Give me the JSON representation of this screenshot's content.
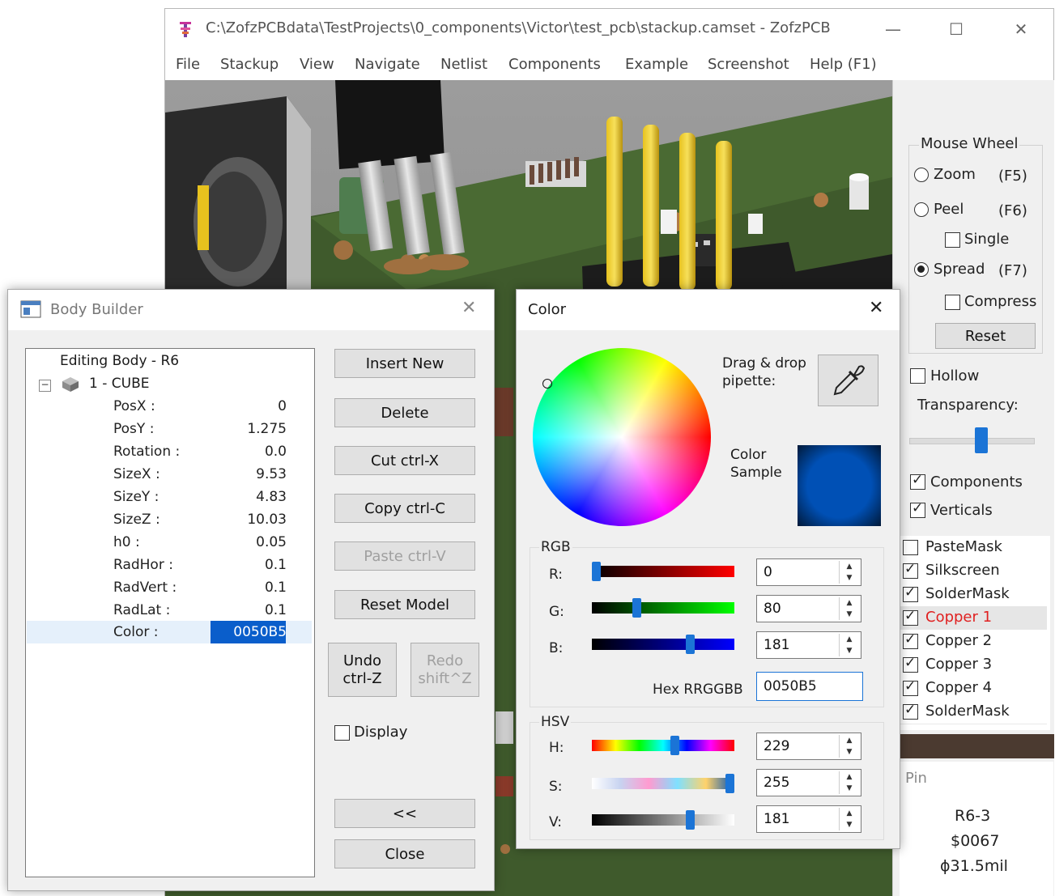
{
  "main_window": {
    "title": "C:\\ZofzPCBdata\\TestProjects\\0_components\\Victor\\test_pcb\\stackup.camset - ZofzPCB",
    "menu": [
      "File",
      "Stackup",
      "View",
      "Navigate",
      "Netlist",
      "Components",
      "Example",
      "Screenshot",
      "Help (F1)"
    ]
  },
  "right_panel": {
    "mouse_wheel_label": "Mouse Wheel",
    "zoom_label": "Zoom",
    "zoom_key": "(F5)",
    "peel_label": "Peel",
    "peel_key": "(F6)",
    "single_label": "Single",
    "spread_label": "Spread",
    "spread_key": "(F7)",
    "compress_label": "Compress",
    "reset_label": "Reset",
    "hollow_label": "Hollow",
    "transparency_label": "Transparency:",
    "transparency_level": 0.58,
    "components_label": "Components",
    "verticals_label": "Verticals",
    "layers": [
      {
        "label": "PasteMask",
        "checked": false
      },
      {
        "label": "Silkscreen",
        "checked": true
      },
      {
        "label": "SolderMask",
        "checked": true
      },
      {
        "label": "Copper  1",
        "checked": true,
        "selected": true
      },
      {
        "label": "Copper  2",
        "checked": true
      },
      {
        "label": "Copper  3",
        "checked": true
      },
      {
        "label": "Copper  4",
        "checked": true
      },
      {
        "label": "SolderMask",
        "checked": true
      }
    ],
    "pin_label": "Pin",
    "pin_ref": "R6-3",
    "pin_net": "$0067",
    "pin_size": "ϕ31.5mil"
  },
  "body_builder": {
    "title": "Body Builder",
    "tree_header": "Editing Body - R6",
    "node_label": "1 - CUBE",
    "properties": [
      {
        "key": "PosX :",
        "value": "0"
      },
      {
        "key": "PosY :",
        "value": "1.275"
      },
      {
        "key": "Rotation :",
        "value": "0.0"
      },
      {
        "key": "SizeX :",
        "value": "9.53"
      },
      {
        "key": "SizeY :",
        "value": "4.83"
      },
      {
        "key": "SizeZ :",
        "value": "10.03"
      },
      {
        "key": "h0 :",
        "value": "0.05"
      },
      {
        "key": "RadHor :",
        "value": "0.1"
      },
      {
        "key": "RadVert :",
        "value": "0.1"
      },
      {
        "key": "RadLat :",
        "value": "0.1"
      },
      {
        "key": "Color :",
        "value": "0050B5"
      }
    ],
    "buttons": {
      "insert_new": "Insert New",
      "delete": "Delete",
      "cut": "Cut  ctrl-X",
      "copy": "Copy  ctrl-C",
      "paste": "Paste  ctrl-V",
      "reset_model": "Reset Model",
      "undo_line1": "Undo",
      "undo_line2": "ctrl-Z",
      "redo_line1": "Redo",
      "redo_line2": "shift^Z",
      "collapse": "<<",
      "close": "Close"
    },
    "display_label": "Display"
  },
  "color_dialog": {
    "title": "Color",
    "pipette_label_1": "Drag & drop",
    "pipette_label_2": "pipette:",
    "sample_label_1": "Color",
    "sample_label_2": "Sample",
    "sample_color": "#0050B5",
    "rgb_group": "RGB",
    "r_label": "R:",
    "r_value": "0",
    "g_label": "G:",
    "g_value": "80",
    "b_label": "B:",
    "b_value": "181",
    "hex_label": "Hex RRGGBB",
    "hex_value": "0050B5",
    "hsv_group": "HSV",
    "h_label": "H:",
    "h_value": "229",
    "s_label": "S:",
    "s_value": "255",
    "v_label": "V:",
    "v_value": "181"
  }
}
